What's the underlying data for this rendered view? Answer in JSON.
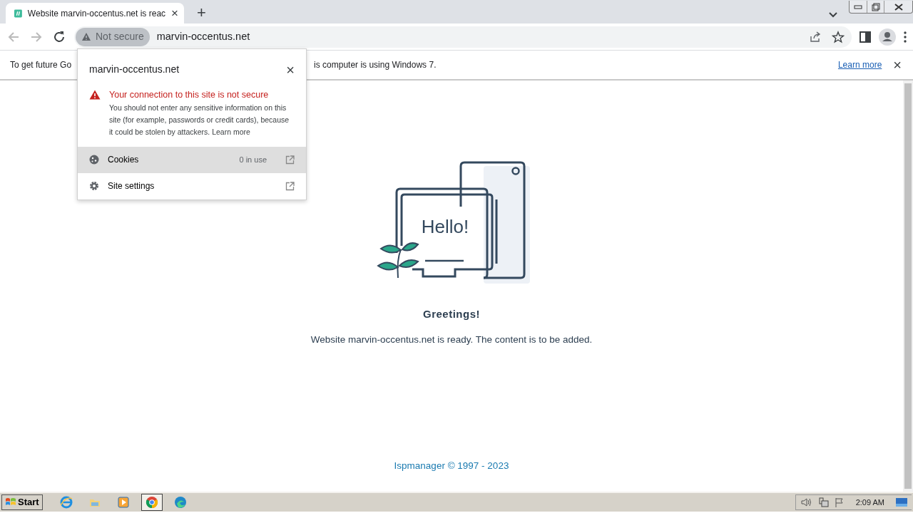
{
  "browser": {
    "tab": {
      "title": "Website marvin-occentus.net is reac",
      "close": "×",
      "selected": true
    },
    "new_tab": "+",
    "address": {
      "security_chip": "Not secure",
      "url": "marvin-occentus.net"
    }
  },
  "infobar": {
    "text_start": "To get future Go",
    "text_end": "is computer is using Windows 7.",
    "link": "Learn more",
    "close": "×"
  },
  "site_popup": {
    "title": "marvin-occentus.net",
    "close": "×",
    "warning": {
      "heading": "Your connection to this site is not secure",
      "body": "You should not enter any sensitive information on this site (for example, passwords or credit cards), because it could be stolen by attackers.",
      "link": "Learn more"
    },
    "items": [
      {
        "kind": "cookies",
        "label": "Cookies",
        "detail": "0 in use",
        "highlighted": true
      },
      {
        "kind": "settings",
        "label": "Site settings",
        "highlighted": false
      }
    ]
  },
  "page": {
    "illustration_text": "Hello!",
    "heading": "Greetings!",
    "message": "Website marvin-occentus.net is ready. The content is to be added.",
    "footer": "Ispmanager © 1997 - 2023"
  },
  "taskbar": {
    "start": "Start",
    "apps": [
      {
        "kind": "ie",
        "selected": false
      },
      {
        "kind": "folder",
        "selected": false
      },
      {
        "kind": "media",
        "selected": false
      },
      {
        "kind": "chrome",
        "selected": true
      },
      {
        "kind": "edge",
        "selected": false
      }
    ],
    "clock": "2:09 AM"
  }
}
